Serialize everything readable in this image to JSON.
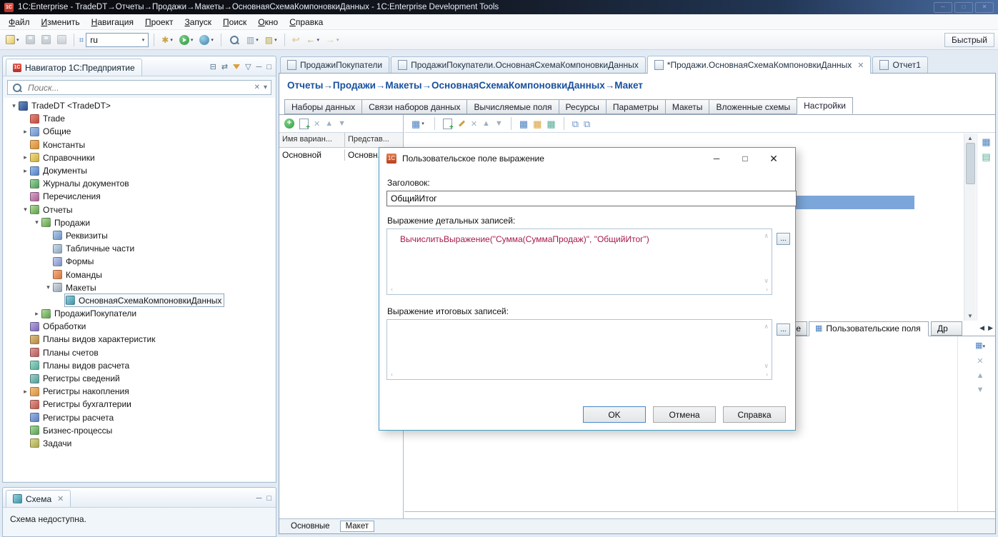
{
  "titlebar": {
    "title": "1C:Enterprise - TradeDT→Отчеты→Продажи→Макеты→ОсновнаяСхемаКомпоновкиДанных - 1C:Enterprise Development Tools"
  },
  "menubar": {
    "items": [
      "Файл",
      "Изменить",
      "Навигация",
      "Проект",
      "Запуск",
      "Поиск",
      "Окно",
      "Справка"
    ]
  },
  "toolbar": {
    "language": "ru",
    "quick_access": "Быстрый"
  },
  "navigator": {
    "title": "Навигатор 1С:Предприятие",
    "search_placeholder": "Поиск...",
    "tree": [
      {
        "label": "TradeDT <TradeDT>",
        "level": 0,
        "arrow": "▾",
        "icon": "configuration-icon"
      },
      {
        "label": "Trade",
        "level": 1,
        "arrow": "",
        "icon": "subsystem-icon"
      },
      {
        "label": "Общие",
        "level": 1,
        "arrow": "▸",
        "icon": "common-icon"
      },
      {
        "label": "Константы",
        "level": 1,
        "arrow": "",
        "icon": "constants-icon"
      },
      {
        "label": "Справочники",
        "level": 1,
        "arrow": "▸",
        "icon": "catalogs-icon"
      },
      {
        "label": "Документы",
        "level": 1,
        "arrow": "▸",
        "icon": "documents-icon"
      },
      {
        "label": "Журналы документов",
        "level": 1,
        "arrow": "",
        "icon": "document-journals-icon"
      },
      {
        "label": "Перечисления",
        "level": 1,
        "arrow": "",
        "icon": "enumerations-icon"
      },
      {
        "label": "Отчеты",
        "level": 1,
        "arrow": "▾",
        "icon": "reports-icon"
      },
      {
        "label": "Продажи",
        "level": 2,
        "arrow": "▾",
        "icon": "report-icon"
      },
      {
        "label": "Реквизиты",
        "level": 3,
        "arrow": "",
        "icon": "attributes-icon"
      },
      {
        "label": "Табличные части",
        "level": 3,
        "arrow": "",
        "icon": "tabular-sections-icon"
      },
      {
        "label": "Формы",
        "level": 3,
        "arrow": "",
        "icon": "forms-icon"
      },
      {
        "label": "Команды",
        "level": 3,
        "arrow": "",
        "icon": "commands-icon"
      },
      {
        "label": "Макеты",
        "level": 3,
        "arrow": "▾",
        "icon": "templates-icon"
      },
      {
        "label": "ОсновнаяСхемаКомпоновкиДанных",
        "level": 4,
        "arrow": "",
        "icon": "dcs-template-icon",
        "selected": true
      },
      {
        "label": "ПродажиПокупатели",
        "level": 2,
        "arrow": "▸",
        "icon": "report-icon"
      },
      {
        "label": "Обработки",
        "level": 1,
        "arrow": "",
        "icon": "data-processors-icon"
      },
      {
        "label": "Планы видов характеристик",
        "level": 1,
        "arrow": "",
        "icon": "charts-of-characteristic-types-icon"
      },
      {
        "label": "Планы счетов",
        "level": 1,
        "arrow": "",
        "icon": "charts-of-accounts-icon"
      },
      {
        "label": "Планы видов расчета",
        "level": 1,
        "arrow": "",
        "icon": "charts-of-calculation-types-icon"
      },
      {
        "label": "Регистры сведений",
        "level": 1,
        "arrow": "",
        "icon": "information-registers-icon"
      },
      {
        "label": "Регистры накопления",
        "level": 1,
        "arrow": "▸",
        "icon": "accumulation-registers-icon"
      },
      {
        "label": "Регистры бухгалтерии",
        "level": 1,
        "arrow": "",
        "icon": "accounting-registers-icon"
      },
      {
        "label": "Регистры расчета",
        "level": 1,
        "arrow": "",
        "icon": "calculation-registers-icon"
      },
      {
        "label": "Бизнес-процессы",
        "level": 1,
        "arrow": "",
        "icon": "business-processes-icon"
      },
      {
        "label": "Задачи",
        "level": 1,
        "arrow": "",
        "icon": "tasks-icon"
      }
    ]
  },
  "schema_panel": {
    "tab": "Схема",
    "message": "Схема недоступна."
  },
  "editor": {
    "tabs": [
      {
        "label": "ПродажиПокупатели"
      },
      {
        "label": "ПродажиПокупатели.ОсновнаяСхемаКомпоновкиДанных"
      },
      {
        "label": "*Продажи.ОсновнаяСхемаКомпоновкиДанных",
        "active": true
      },
      {
        "label": "Отчет1"
      }
    ],
    "breadcrumb": "Отчеты→Продажи→Макеты→ОсновнаяСхемаКомпоновкиДанных→Макет",
    "subtabs": [
      "Наборы данных",
      "Связи наборов данных",
      "Вычисляемые поля",
      "Ресурсы",
      "Параметры",
      "Макеты",
      "Вложенные схемы",
      "Настройки"
    ],
    "active_subtab": "Настройки",
    "variants_table": {
      "columns": [
        "Имя вариан...",
        "Представ..."
      ],
      "row": [
        "Основной",
        "Основн..."
      ]
    },
    "settings_tabs": {
      "left_partial": "е",
      "active": "Пользовательские поля",
      "right_partial": "Др"
    },
    "bottom_tabs": [
      "Основные",
      "Макет"
    ],
    "active_bottom_tab": "Макет"
  },
  "dialog": {
    "title": "Пользовательское поле выражение",
    "caption_label": "Заголовок:",
    "caption_value": "ОбщийИтог",
    "detail_label": "Выражение детальных записей:",
    "detail_expression": "ВычислитьВыражение(\"Сумма(СуммаПродаж)\", \"ОбщийИтог\")",
    "totals_label": "Выражение итоговых записей:",
    "totals_expression": "",
    "more_button": "...",
    "ok": "OK",
    "cancel": "Отмена",
    "help": "Справка"
  },
  "colors": {
    "breadcrumb_blue": "#17509e",
    "selection_blue": "#7ba6d9",
    "expression_red": "#a6194a",
    "dialog_border": "#3f9fc4"
  }
}
